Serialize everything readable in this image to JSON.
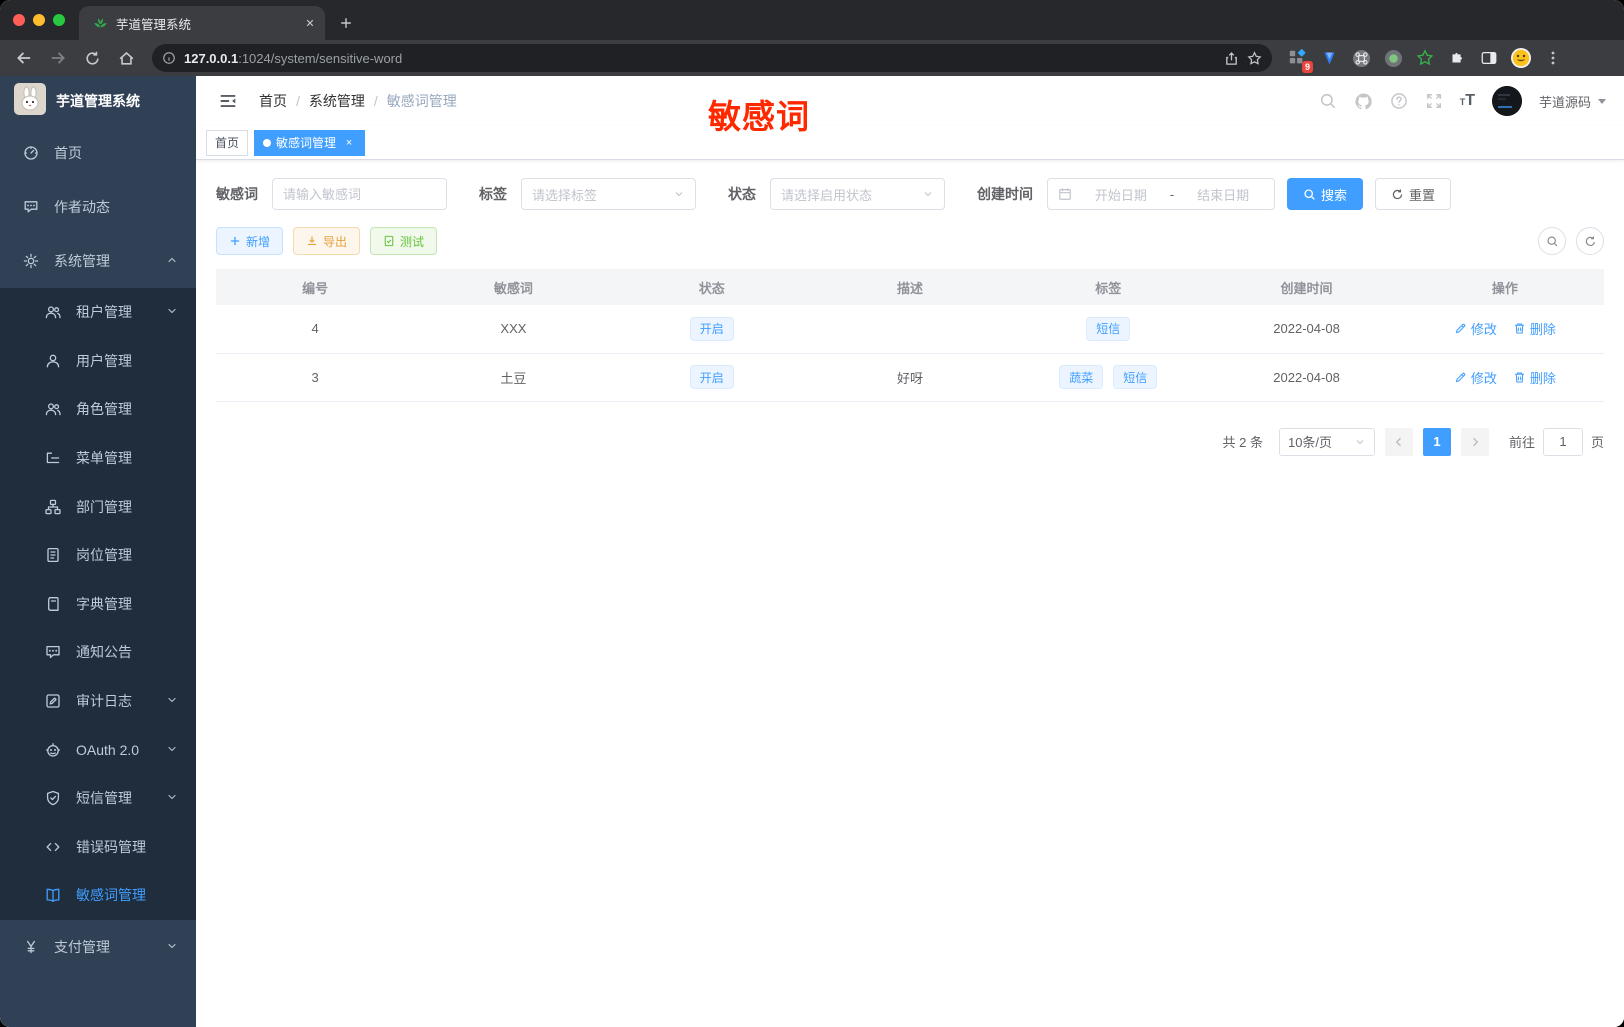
{
  "browser": {
    "tab_title": "芋道管理系统",
    "url_host": "127.0.0.1",
    "url_path": ":1024/system/sensitive-word",
    "extension_badge": "9"
  },
  "sidebar": {
    "title": "芋道管理系统",
    "items": [
      {
        "id": "home",
        "label": "首页",
        "icon": "dashboard-icon",
        "level": 1
      },
      {
        "id": "author-activity",
        "label": "作者动态",
        "icon": "chat-icon",
        "level": 1
      },
      {
        "id": "system",
        "label": "系统管理",
        "icon": "gear-icon",
        "level": 1,
        "chevron": "up"
      },
      {
        "id": "tenant",
        "label": "租户管理",
        "icon": "users-icon",
        "level": 2,
        "chevron": "down"
      },
      {
        "id": "user",
        "label": "用户管理",
        "icon": "user-icon",
        "level": 2
      },
      {
        "id": "role",
        "label": "角色管理",
        "icon": "users-icon",
        "level": 2
      },
      {
        "id": "menu",
        "label": "菜单管理",
        "icon": "tree-icon",
        "level": 2
      },
      {
        "id": "dept",
        "label": "部门管理",
        "icon": "org-icon",
        "level": 2
      },
      {
        "id": "post",
        "label": "岗位管理",
        "icon": "badge-icon",
        "level": 2
      },
      {
        "id": "dict",
        "label": "字典管理",
        "icon": "book-icon",
        "level": 2
      },
      {
        "id": "notice",
        "label": "通知公告",
        "icon": "comment-icon",
        "level": 2
      },
      {
        "id": "audit-log",
        "label": "审计日志",
        "icon": "edit-icon",
        "level": 2,
        "chevron": "down"
      },
      {
        "id": "oauth",
        "label": "OAuth 2.0",
        "icon": "robot-icon",
        "level": 2,
        "chevron": "down"
      },
      {
        "id": "sms",
        "label": "短信管理",
        "icon": "shield-icon",
        "level": 2,
        "chevron": "down"
      },
      {
        "id": "error-code",
        "label": "错误码管理",
        "icon": "code-icon",
        "level": 2
      },
      {
        "id": "sensitive-word",
        "label": "敏感词管理",
        "icon": "open-book-icon",
        "level": 2,
        "active": true
      },
      {
        "id": "pay",
        "label": "支付管理",
        "icon": "yen-icon",
        "level": 1,
        "chevron": "down"
      }
    ]
  },
  "header": {
    "breadcrumb": [
      "首页",
      "系统管理",
      "敏感词管理"
    ],
    "breadcrumb_sep": "/",
    "username": "芋道源码"
  },
  "annotation": {
    "text": "敏感词",
    "color": "#ff2900"
  },
  "tags_view": {
    "tags": [
      {
        "label": "首页",
        "active": false
      },
      {
        "label": "敏感词管理",
        "active": true,
        "closable": true
      }
    ]
  },
  "filters": {
    "word_label": "敏感词",
    "word_placeholder": "请输入敏感词",
    "tag_label": "标签",
    "tag_placeholder": "请选择标签",
    "status_label": "状态",
    "status_placeholder": "请选择启用状态",
    "date_label": "创建时间",
    "date_start_placeholder": "开始日期",
    "date_separator": "-",
    "date_end_placeholder": "结束日期",
    "search_label": "搜索",
    "reset_label": "重置"
  },
  "actions": {
    "add_label": "新增",
    "export_label": "导出",
    "test_label": "测试"
  },
  "table": {
    "columns": [
      "编号",
      "敏感词",
      "状态",
      "描述",
      "标签",
      "创建时间",
      "操作"
    ],
    "rows": [
      {
        "id": "4",
        "word": "XXX",
        "status": "开启",
        "description": "",
        "tags": [
          "短信"
        ],
        "created": "2022-04-08"
      },
      {
        "id": "3",
        "word": "土豆",
        "status": "开启",
        "description": "好呀",
        "tags": [
          "蔬菜",
          "短信"
        ],
        "created": "2022-04-08"
      }
    ],
    "edit_label": "修改",
    "delete_label": "删除"
  },
  "pagination": {
    "total_text": "共 2 条",
    "page_size_text": "10条/页",
    "page": "1",
    "goto_prefix": "前往",
    "goto_value": "1",
    "goto_suffix": "页"
  },
  "colors": {
    "accent": "#409eff",
    "sidebar_bg": "#304156",
    "submenu_bg": "#1f2d3d",
    "warning": "#e6a23c",
    "success": "#67c23a",
    "annotation_red": "#ff2900"
  }
}
